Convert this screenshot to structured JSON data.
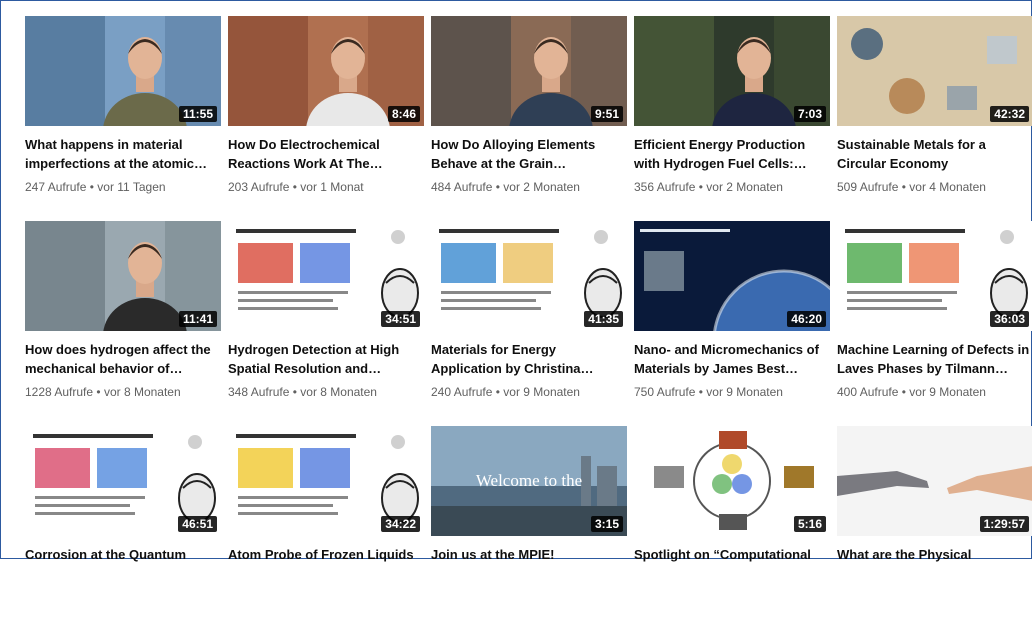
{
  "videos": [
    {
      "title": "What happens in material imperfections at the atomic…",
      "duration": "11:55",
      "views": "247 Aufrufe",
      "age": "vor 11 Tagen",
      "thumb": "portrait",
      "colors": [
        "#7a9fc4",
        "#4a6f93",
        "#6b6a4a"
      ]
    },
    {
      "title": "How Do Electrochemical Reactions Work At The…",
      "duration": "8:46",
      "views": "203 Aufrufe",
      "age": "vor 1 Monat",
      "thumb": "portrait",
      "colors": [
        "#b07050",
        "#8a4a32",
        "#e8e8e8"
      ]
    },
    {
      "title": "How Do Alloying Elements Behave at the Grain…",
      "duration": "9:51",
      "views": "484 Aufrufe",
      "age": "vor 2 Monaten",
      "thumb": "portrait",
      "colors": [
        "#8a6a55",
        "#4a4a48",
        "#2f3f55"
      ]
    },
    {
      "title": "Efficient Energy Production with Hydrogen Fuel Cells:…",
      "duration": "7:03",
      "views": "356 Aufrufe",
      "age": "vor 2 Monaten",
      "thumb": "portrait",
      "colors": [
        "#2e3a2c",
        "#4e5f3a",
        "#1e2540"
      ]
    },
    {
      "title": "Sustainable Metals for a Circular Economy",
      "duration": "42:32",
      "views": "509 Aufrufe",
      "age": "vor 4 Monaten",
      "thumb": "metals",
      "colors": [
        "#d8c8a8",
        "#b88a5a",
        "#5a6f80"
      ]
    },
    {
      "title": "How does hydrogen affect the mechanical behavior of…",
      "duration": "11:41",
      "views": "1228 Aufrufe",
      "age": "vor 8 Monaten",
      "thumb": "portrait",
      "colors": [
        "#9aa8b0",
        "#6a7880",
        "#2a2a2a"
      ]
    },
    {
      "title": "Hydrogen Detection at High Spatial Resolution and…",
      "duration": "34:51",
      "views": "348 Aufrufe",
      "age": "vor 8 Monaten",
      "thumb": "slide",
      "colors": [
        "#ffffff",
        "#d84a3a",
        "#3a6ad8"
      ]
    },
    {
      "title": "Materials for Energy Application by Christina…",
      "duration": "41:35",
      "views": "240 Aufrufe",
      "age": "vor 9 Monaten",
      "thumb": "slide",
      "colors": [
        "#ffffff",
        "#3a8ad0",
        "#e8b84a"
      ]
    },
    {
      "title": "Nano- and Micromechanics of Materials by James Best…",
      "duration": "46:20",
      "views": "750 Aufrufe",
      "age": "vor 9 Monaten",
      "thumb": "space",
      "colors": [
        "#0a1a3a",
        "#3a6ab0",
        "#e0e8f0"
      ]
    },
    {
      "title": "Machine Learning of Defects in Laves Phases by Tilmann…",
      "duration": "36:03",
      "views": "400 Aufrufe",
      "age": "vor 9 Monaten",
      "thumb": "slide",
      "colors": [
        "#ffffff",
        "#4aa84a",
        "#e86a3a"
      ]
    },
    {
      "title": "Corrosion at the Quantum",
      "duration": "46:51",
      "views": "",
      "age": "",
      "thumb": "slide",
      "colors": [
        "#ffffff",
        "#d84a6a",
        "#3a7ad8"
      ]
    },
    {
      "title": "Atom Probe of Frozen Liquids",
      "duration": "34:22",
      "views": "",
      "age": "",
      "thumb": "slide",
      "colors": [
        "#ffffff",
        "#f0c830",
        "#3a6ad8"
      ]
    },
    {
      "title": "Join us at the MPIE!",
      "duration": "3:15",
      "views": "",
      "age": "",
      "thumb": "city",
      "overlay": "Welcome to the",
      "colors": [
        "#8aa8c0",
        "#506a80",
        "#3a4a55"
      ]
    },
    {
      "title": "Spotlight on “Computational",
      "duration": "5:16",
      "views": "",
      "age": "",
      "thumb": "cycle",
      "colors": [
        "#ffffff",
        "#4aa84a",
        "#3a6ad8"
      ]
    },
    {
      "title": "What are the Physical",
      "duration": "1:29:57",
      "views": "",
      "age": "",
      "thumb": "hands",
      "colors": [
        "#f4f4f4",
        "#7a7a80",
        "#e0b090"
      ]
    }
  ]
}
